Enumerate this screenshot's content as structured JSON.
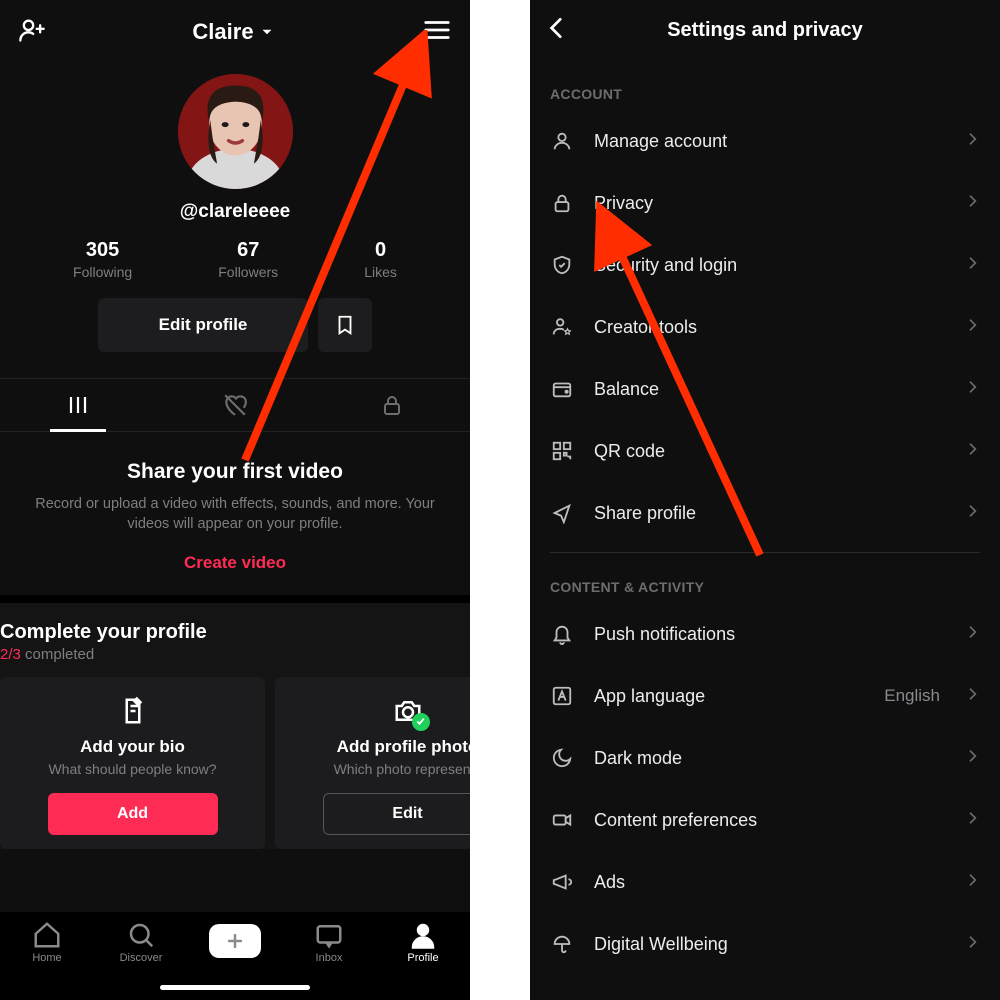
{
  "left": {
    "header": {
      "account_name": "Claire"
    },
    "profile": {
      "handle": "@clareleeee",
      "stats": {
        "following": {
          "count": "305",
          "label": "Following"
        },
        "followers": {
          "count": "67",
          "label": "Followers"
        },
        "likes": {
          "count": "0",
          "label": "Likes"
        }
      },
      "edit_label": "Edit profile"
    },
    "empty": {
      "title": "Share your first video",
      "body": "Record or upload a video with effects, sounds, and more. Your videos will appear on your profile.",
      "cta": "Create video"
    },
    "complete": {
      "title": "Complete your profile",
      "progress_done": "2/3",
      "progress_tail": " completed",
      "cards": [
        {
          "icon": "doc-pencil",
          "title": "Add your bio",
          "sub": "What should people know?",
          "button": "Add",
          "primary": true
        },
        {
          "icon": "camera-check",
          "title": "Add profile photo",
          "sub": "Which photo represents",
          "button": "Edit",
          "primary": false
        }
      ]
    },
    "nav": {
      "home": "Home",
      "discover": "Discover",
      "inbox": "Inbox",
      "profile": "Profile"
    }
  },
  "right": {
    "title": "Settings and privacy",
    "section_account": "ACCOUNT",
    "section_content": "CONTENT & ACTIVITY",
    "rows": {
      "manage": "Manage account",
      "privacy": "Privacy",
      "security": "Security and login",
      "creator": "Creator tools",
      "balance": "Balance",
      "qr": "QR code",
      "share": "Share profile",
      "push": "Push notifications",
      "lang": "App language",
      "lang_val": "English",
      "dark": "Dark mode",
      "content": "Content preferences",
      "ads": "Ads",
      "digital": "Digital Wellbeing"
    }
  }
}
